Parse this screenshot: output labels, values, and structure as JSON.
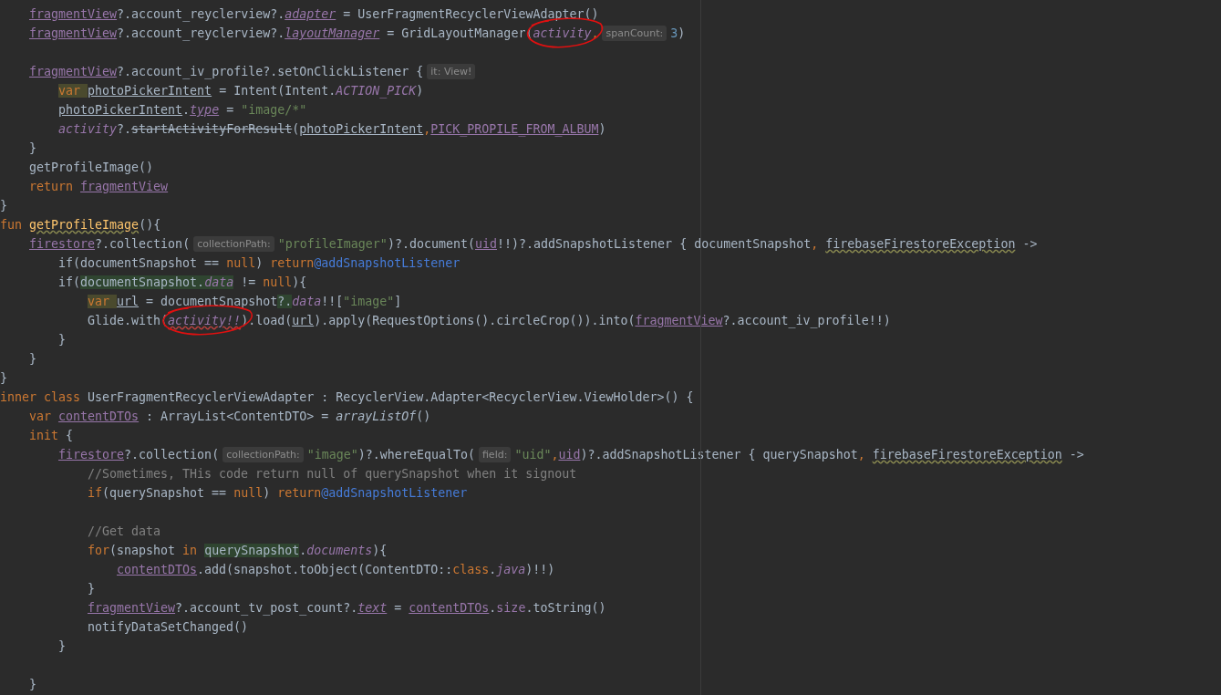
{
  "editor": {
    "lines": [
      {
        "kind": "block",
        "children": [
          {
            "kind": "code",
            "tokens": [
              {
                "text": "fragmentView",
                "kind": "member"
              },
              {
                "text": "?.account_reyclerview?.",
                "kind": "plain"
              },
              {
                "text": "adapter",
                "kind": "property"
              },
              {
                "text": " = UserFragmentRecyclerViewAdapter()",
                "kind": "plain"
              }
            ]
          },
          {
            "kind": "code",
            "tokens": [
              {
                "text": "fragmentView",
                "kind": "member"
              },
              {
                "text": "?.account_reyclerview?.",
                "kind": "plain"
              },
              {
                "text": "layoutManager",
                "kind": "property"
              },
              {
                "text": " = GridLayoutManager(",
                "kind": "plain"
              },
              {
                "text": "activity",
                "kind": "synthetic",
                "circled": true
              },
              {
                "text": ",",
                "kind": "keyword"
              },
              {
                "text": "spanCount:",
                "kind": "hint"
              },
              {
                "text": "3",
                "kind": "number"
              },
              {
                "text": ")",
                "kind": "plain"
              }
            ]
          },
          {
            "kind": "blank"
          },
          {
            "kind": "code",
            "tokens": [
              {
                "text": "fragmentView",
                "kind": "member"
              },
              {
                "text": "?.account_iv_profile?.setOnClickListener {",
                "kind": "plain"
              },
              {
                "text": "it: View!",
                "kind": "hint"
              }
            ],
            "children": [
              {
                "kind": "code",
                "tokens": [
                  {
                    "text": "var ",
                    "kind": "markedkeyword"
                  },
                  {
                    "text": "photoPickerIntent",
                    "kind": "local"
                  },
                  {
                    "text": " = Intent(Intent.",
                    "kind": "plain"
                  },
                  {
                    "text": "ACTION_PICK",
                    "kind": "constant"
                  },
                  {
                    "text": ")",
                    "kind": "plain"
                  }
                ]
              },
              {
                "kind": "code",
                "tokens": [
                  {
                    "text": "photoPickerIntent",
                    "kind": "local"
                  },
                  {
                    "text": ".",
                    "kind": "plain"
                  },
                  {
                    "text": "type",
                    "kind": "property"
                  },
                  {
                    "text": " = ",
                    "kind": "plain"
                  },
                  {
                    "text": "\"image/*\"",
                    "kind": "string"
                  }
                ]
              },
              {
                "kind": "code",
                "tokens": [
                  {
                    "text": "activity",
                    "kind": "synthetic"
                  },
                  {
                    "text": "?.",
                    "kind": "plain"
                  },
                  {
                    "text": "startActivityForResult",
                    "kind": "deprecated"
                  },
                  {
                    "text": "(",
                    "kind": "plain"
                  },
                  {
                    "text": "photoPickerIntent",
                    "kind": "local"
                  },
                  {
                    "text": ",",
                    "kind": "keyword"
                  },
                  {
                    "text": "PICK_PROPILE_FROM_ALBUM",
                    "kind": "member"
                  },
                  {
                    "text": ")",
                    "kind": "plain"
                  }
                ]
              }
            ]
          },
          {
            "kind": "code",
            "tokens": [
              {
                "text": "}",
                "kind": "plain"
              }
            ]
          },
          {
            "kind": "code",
            "tokens": [
              {
                "text": "getProfileImage()",
                "kind": "plain"
              }
            ]
          },
          {
            "kind": "code",
            "tokens": [
              {
                "text": "return ",
                "kind": "keyword"
              },
              {
                "text": "fragmentView",
                "kind": "member"
              }
            ]
          }
        ]
      },
      {
        "kind": "code",
        "tokens": [
          {
            "text": "}",
            "kind": "plain"
          }
        ]
      },
      {
        "kind": "code",
        "tokens": [
          {
            "text": "fun ",
            "kind": "keyword"
          },
          {
            "text": "getProfileImage",
            "kind": "function"
          },
          {
            "text": "(){",
            "kind": "plain"
          }
        ],
        "children": [
          {
            "kind": "code",
            "tokens": [
              {
                "text": "firestore",
                "kind": "member"
              },
              {
                "text": "?.collection(",
                "kind": "plain"
              },
              {
                "text": "collectionPath:",
                "kind": "hint"
              },
              {
                "text": "\"profileImager\"",
                "kind": "string"
              },
              {
                "text": ")?.document(",
                "kind": "plain"
              },
              {
                "text": "uid",
                "kind": "member"
              },
              {
                "text": "!!)?.addSnapshotListener { documentSnapshot",
                "kind": "plain"
              },
              {
                "text": ", ",
                "kind": "keyword"
              },
              {
                "text": "firebaseFirestoreException",
                "kind": "warning"
              },
              {
                "text": " ->",
                "kind": "plain"
              }
            ],
            "children": [
              {
                "kind": "code",
                "tokens": [
                  {
                    "text": "if(documentSnapshot == ",
                    "kind": "plain"
                  },
                  {
                    "text": "null",
                    "kind": "keyword"
                  },
                  {
                    "text": ") ",
                    "kind": "plain"
                  },
                  {
                    "text": "return",
                    "kind": "keyword"
                  },
                  {
                    "text": "@addSnapshotListener",
                    "kind": "label"
                  }
                ]
              },
              {
                "kind": "code",
                "tokens": [
                  {
                    "text": "if(",
                    "kind": "plain"
                  },
                  {
                    "text": "documentSnapshot.",
                    "kind": "markedplain"
                  },
                  {
                    "text": "data",
                    "kind": "markedsynthetic"
                  },
                  {
                    "text": " != ",
                    "kind": "plain"
                  },
                  {
                    "text": "null",
                    "kind": "keyword"
                  },
                  {
                    "text": "){",
                    "kind": "plain"
                  }
                ],
                "children": [
                  {
                    "kind": "code",
                    "tokens": [
                      {
                        "text": "var ",
                        "kind": "markedkeyword"
                      },
                      {
                        "text": "url",
                        "kind": "local"
                      },
                      {
                        "text": " = documentSnapshot",
                        "kind": "plain"
                      },
                      {
                        "text": "?.",
                        "kind": "markedplain"
                      },
                      {
                        "text": "data",
                        "kind": "synthetic"
                      },
                      {
                        "text": "!![",
                        "kind": "plain"
                      },
                      {
                        "text": "\"image\"",
                        "kind": "string"
                      },
                      {
                        "text": "]",
                        "kind": "plain"
                      }
                    ]
                  },
                  {
                    "kind": "code",
                    "tokens": [
                      {
                        "text": "Glide.with(",
                        "kind": "plain"
                      },
                      {
                        "text": "activity!!",
                        "kind": "warnsynthetic",
                        "circled": true
                      },
                      {
                        "text": ").load(",
                        "kind": "plain"
                      },
                      {
                        "text": "url",
                        "kind": "local"
                      },
                      {
                        "text": ").apply(RequestOptions().circleCrop()).into(",
                        "kind": "plain"
                      },
                      {
                        "text": "fragmentView",
                        "kind": "member"
                      },
                      {
                        "text": "?.account_iv_profile!!)",
                        "kind": "plain"
                      }
                    ]
                  }
                ]
              },
              {
                "kind": "code",
                "tokens": [
                  {
                    "text": "}",
                    "kind": "plain"
                  }
                ]
              }
            ]
          },
          {
            "kind": "code",
            "tokens": [
              {
                "text": "}",
                "kind": "plain"
              }
            ]
          }
        ]
      },
      {
        "kind": "code",
        "tokens": [
          {
            "text": "}",
            "kind": "plain"
          }
        ]
      },
      {
        "kind": "code",
        "tokens": [
          {
            "text": "inner class",
            "kind": "keyword"
          },
          {
            "text": " UserFragmentRecyclerViewAdapter : RecyclerView.Adapter<RecyclerView.ViewHolder>() {",
            "kind": "plain"
          }
        ],
        "children": [
          {
            "kind": "code",
            "tokens": [
              {
                "text": "var ",
                "kind": "keyword"
              },
              {
                "text": "contentDTOs",
                "kind": "member"
              },
              {
                "text": " : ArrayList<ContentDTO> = ",
                "kind": "plain"
              },
              {
                "text": "arrayListOf",
                "kind": "italic"
              },
              {
                "text": "()",
                "kind": "plain"
              }
            ]
          },
          {
            "kind": "code",
            "tokens": [
              {
                "text": "init",
                "kind": "keyword"
              },
              {
                "text": " {",
                "kind": "plain"
              }
            ],
            "children": [
              {
                "kind": "code",
                "tokens": [
                  {
                    "text": "firestore",
                    "kind": "member"
                  },
                  {
                    "text": "?.collection(",
                    "kind": "plain"
                  },
                  {
                    "text": "collectionPath:",
                    "kind": "hint"
                  },
                  {
                    "text": "\"image\"",
                    "kind": "string"
                  },
                  {
                    "text": ")?.whereEqualTo(",
                    "kind": "plain"
                  },
                  {
                    "text": "field:",
                    "kind": "hint"
                  },
                  {
                    "text": "\"uid\"",
                    "kind": "string"
                  },
                  {
                    "text": ",",
                    "kind": "keyword"
                  },
                  {
                    "text": "uid",
                    "kind": "member"
                  },
                  {
                    "text": ")?.addSnapshotListener { querySnapshot",
                    "kind": "plain"
                  },
                  {
                    "text": ", ",
                    "kind": "keyword"
                  },
                  {
                    "text": "firebaseFirestoreException",
                    "kind": "warning"
                  },
                  {
                    "text": " ->",
                    "kind": "plain"
                  }
                ],
                "children": [
                  {
                    "kind": "code",
                    "tokens": [
                      {
                        "text": "//Sometimes, THis code return null of querySnapshot when it signout",
                        "kind": "comment"
                      }
                    ]
                  },
                  {
                    "kind": "code",
                    "tokens": [
                      {
                        "text": "if",
                        "kind": "keyword"
                      },
                      {
                        "text": "(querySnapshot == ",
                        "kind": "plain"
                      },
                      {
                        "text": "null",
                        "kind": "keyword"
                      },
                      {
                        "text": ") ",
                        "kind": "plain"
                      },
                      {
                        "text": "return",
                        "kind": "keyword"
                      },
                      {
                        "text": "@addSnapshotListener",
                        "kind": "label"
                      }
                    ]
                  },
                  {
                    "kind": "blank"
                  },
                  {
                    "kind": "code",
                    "tokens": [
                      {
                        "text": "//Get data",
                        "kind": "comment"
                      }
                    ]
                  },
                  {
                    "kind": "code",
                    "tokens": [
                      {
                        "text": "for",
                        "kind": "keyword"
                      },
                      {
                        "text": "(snapshot ",
                        "kind": "plain"
                      },
                      {
                        "text": "in ",
                        "kind": "keyword"
                      },
                      {
                        "text": "querySnapshot",
                        "kind": "markedplain"
                      },
                      {
                        "text": ".",
                        "kind": "plain"
                      },
                      {
                        "text": "documents",
                        "kind": "synthetic"
                      },
                      {
                        "text": "){",
                        "kind": "plain"
                      }
                    ],
                    "children": [
                      {
                        "kind": "code",
                        "tokens": [
                          {
                            "text": "contentDTOs",
                            "kind": "member"
                          },
                          {
                            "text": ".add(snapshot.toObject(ContentDTO::",
                            "kind": "plain"
                          },
                          {
                            "text": "class",
                            "kind": "keyword"
                          },
                          {
                            "text": ".",
                            "kind": "plain"
                          },
                          {
                            "text": "java",
                            "kind": "synthetic"
                          },
                          {
                            "text": ")!!)",
                            "kind": "plain"
                          }
                        ]
                      }
                    ]
                  },
                  {
                    "kind": "code",
                    "tokens": [
                      {
                        "text": "}",
                        "kind": "plain"
                      }
                    ]
                  },
                  {
                    "kind": "code",
                    "tokens": [
                      {
                        "text": "fragmentView",
                        "kind": "member"
                      },
                      {
                        "text": "?.account_tv_post_count?.",
                        "kind": "plain"
                      },
                      {
                        "text": "text",
                        "kind": "property"
                      },
                      {
                        "text": " = ",
                        "kind": "plain"
                      },
                      {
                        "text": "contentDTOs",
                        "kind": "member"
                      },
                      {
                        "text": ".",
                        "kind": "plain"
                      },
                      {
                        "text": "size",
                        "kind": "field"
                      },
                      {
                        "text": ".toString()",
                        "kind": "plain"
                      }
                    ]
                  },
                  {
                    "kind": "code",
                    "tokens": [
                      {
                        "text": "notifyDataSetChanged()",
                        "kind": "plain"
                      }
                    ]
                  }
                ]
              },
              {
                "kind": "code",
                "tokens": [
                  {
                    "text": "}",
                    "kind": "plain"
                  }
                ]
              },
              {
                "kind": "blank"
              }
            ]
          },
          {
            "kind": "code",
            "tokens": [
              {
                "text": "}",
                "kind": "plain"
              }
            ]
          }
        ]
      }
    ]
  }
}
